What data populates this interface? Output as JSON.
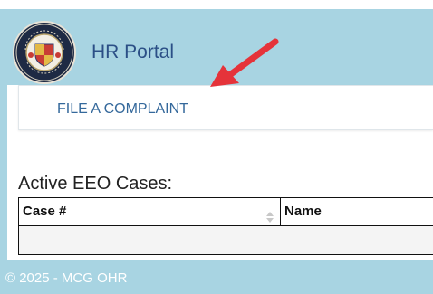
{
  "header": {
    "brand_title": "HR Portal",
    "seal_text": "MONTGOMERY COUNTY MARYLAND"
  },
  "nav": {
    "file_complaint_label": "FILE A COMPLAINT"
  },
  "cases": {
    "title": "Active EEO Cases:",
    "columns": [
      "Case #",
      "Name"
    ],
    "rows": []
  },
  "footer": {
    "text": "© 2025 - MCG OHR"
  },
  "colors": {
    "app_background": "#a8d4e2",
    "brand_text": "#2b4f86",
    "link_text": "#34689b",
    "annotation_arrow": "#e5333a"
  },
  "icons": {
    "seal": "county-seal-icon",
    "sort": "sort-icon",
    "annotation": "red-arrow-icon"
  }
}
